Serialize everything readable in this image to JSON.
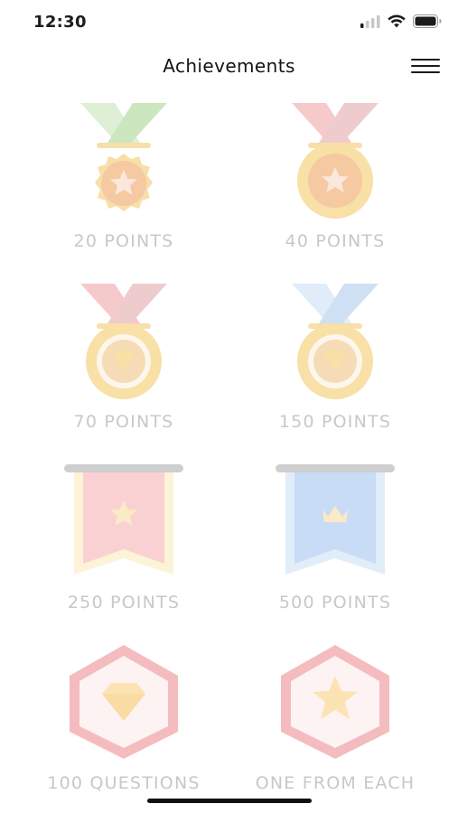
{
  "status_bar": {
    "time": "12:30",
    "icons": [
      "cellular-signal-icon",
      "wifi-icon",
      "battery-icon"
    ]
  },
  "header": {
    "title": "Achievements",
    "menu_icon": "hamburger-menu-icon"
  },
  "achievements": [
    {
      "label": "20 POINTS",
      "icon": "star-medal-green-ribbon-icon"
    },
    {
      "label": "40 POINTS",
      "icon": "star-medal-red-ribbon-icon"
    },
    {
      "label": "70 POINTS",
      "icon": "gem-medal-red-ribbon-icon"
    },
    {
      "label": "150 POINTS",
      "icon": "gem-medal-blue-ribbon-icon"
    },
    {
      "label": "250 POINTS",
      "icon": "star-banner-red-icon"
    },
    {
      "label": "500 POINTS",
      "icon": "crown-banner-blue-icon"
    },
    {
      "label": "100 QUESTIONS",
      "icon": "gem-hexagon-icon"
    },
    {
      "label": "ONE FROM EACH",
      "icon": "star-hexagon-icon"
    }
  ],
  "colors": {
    "label_gray": "#c8c8c8",
    "gold": "#f8dc9c",
    "ribbon_green": "#d4ecc8",
    "ribbon_red": "#f6c6c8",
    "ribbon_blue": "#d2e4f8",
    "banner_red": "#f9d1d3",
    "banner_blue": "#c9dcf6",
    "hex_outline": "#f4bcbf"
  }
}
